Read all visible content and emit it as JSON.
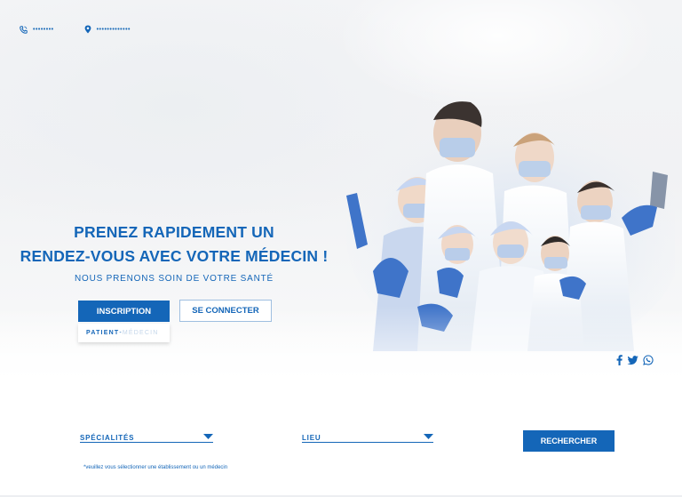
{
  "topbar": {
    "phone_value": "••••••••",
    "address_value": "•••••••••••••",
    "phone_icon": "phone-icon",
    "location_icon": "location-pin-icon"
  },
  "hero": {
    "title_line1": "PRENEZ RAPIDEMENT UN",
    "title_line2": "RENDEZ-VOUS AVEC VOTRE MÉDECIN !",
    "subtitle": "NOUS PRENONS SOIN DE VOTRE SANTÉ",
    "inscription_label": "INSCRIPTION",
    "connect_label": "SE CONNECTER",
    "role_patient": "PATIENT",
    "role_separator": "-",
    "role_medecin": "MÉDECIN"
  },
  "social": {
    "icons": [
      "facebook-icon",
      "twitter-icon",
      "whatsapp-icon"
    ]
  },
  "search": {
    "specialites_label": "SPÉCIALITÉS",
    "lieu_label": "LIEU",
    "search_label": "RECHERCHER",
    "note": "*veuillez vous sélectionner une établissement ou un médecin"
  },
  "colors": {
    "primary": "#1466b8",
    "light_border": "#9fbfe0",
    "background": "#f3f4f6"
  }
}
